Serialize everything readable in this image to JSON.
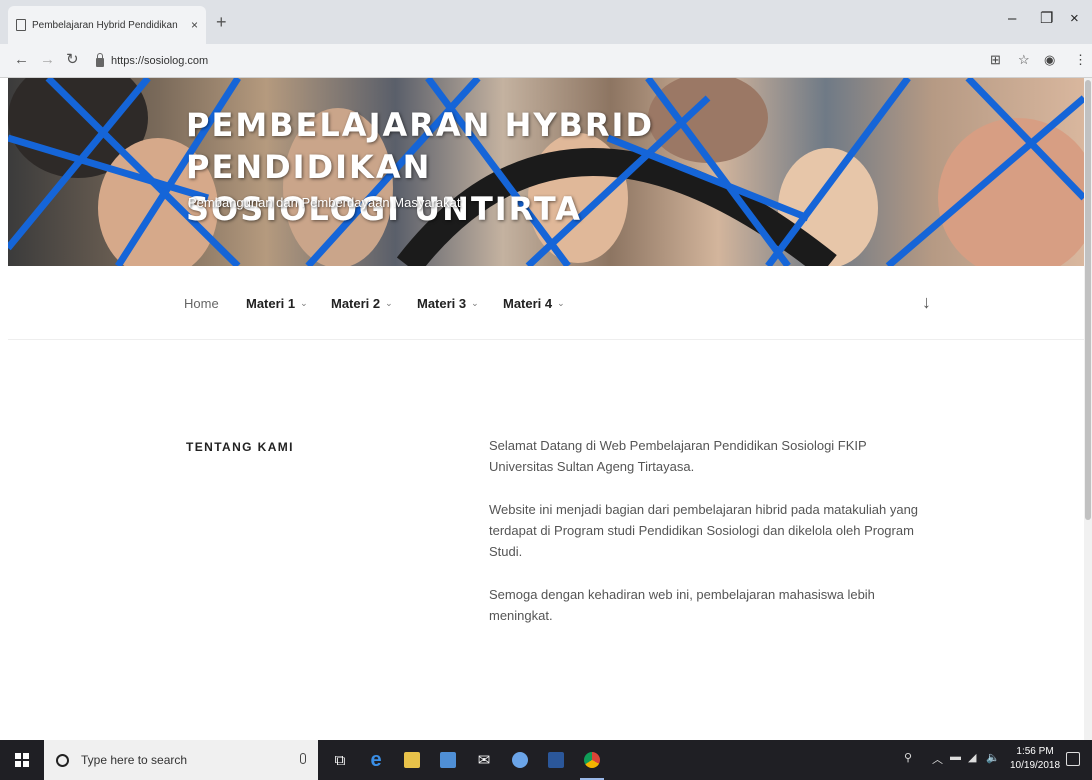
{
  "browser": {
    "tab_title": "Pembelajaran Hybrid Pendidikan",
    "tab_close": "×",
    "new_tab": "+",
    "url": "https://sosiolog.com",
    "window_controls": {
      "minimize": "–",
      "maximize": "❐",
      "close": "×"
    }
  },
  "site": {
    "title_line1": "PEMBELAJARAN HYBRID PENDIDIKAN",
    "title_line2": "SOSIOLOGI UNTIRTA",
    "tagline": "Pembangunan dan Pemberdayaan Masyarakat"
  },
  "nav": {
    "items": [
      {
        "label": "Home",
        "has_menu": false
      },
      {
        "label": "Materi 1",
        "has_menu": true
      },
      {
        "label": "Materi 2",
        "has_menu": true
      },
      {
        "label": "Materi 3",
        "has_menu": true
      },
      {
        "label": "Materi 4",
        "has_menu": true
      }
    ],
    "chevron": "⌄",
    "scroll_down": "↓"
  },
  "section": {
    "heading": "TENTANG KAMI",
    "paragraphs": [
      "Selamat Datang di Web Pembelajaran Pendidikan Sosiologi FKIP Universitas Sultan Ageng Tirtayasa.",
      "Website ini menjadi bagian dari pembelajaran hibrid pada matakuliah yang terdapat di Program studi Pendidikan Sosiologi dan dikelola oleh Program Studi.",
      "Semoga dengan kehadiran web ini, pembelajaran mahasiswa lebih meningkat."
    ]
  },
  "taskbar": {
    "search_placeholder": "Type here to search",
    "time": "1:56 PM",
    "date": "10/19/2018"
  },
  "colors": {
    "banner_accent": "#1565d8",
    "taskbar": "#1f1f24"
  }
}
